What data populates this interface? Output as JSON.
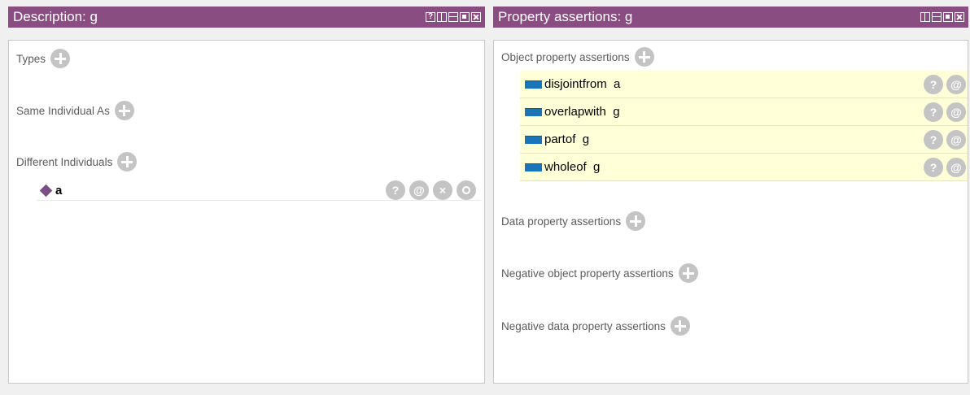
{
  "left_panel": {
    "title": "Description: g",
    "sections": {
      "types": "Types",
      "same_individual": "Same Individual As",
      "different_individuals": "Different Individuals"
    },
    "different_individuals_items": [
      "a"
    ]
  },
  "right_panel": {
    "title": "Property assertions: g",
    "sections": {
      "object_property": "Object property assertions",
      "data_property": "Data property assertions",
      "negative_object": "Negative object property assertions",
      "negative_data": "Negative data property assertions"
    },
    "object_property_assertions": [
      "disjointfrom  a",
      "overlapwith  g",
      "partof  g",
      "wholeof  g"
    ]
  },
  "buttons": {
    "help": "?",
    "annotate": "@",
    "delete": "×"
  },
  "colors": {
    "title_bar": "#894d82",
    "assertion_highlight": "#ffffd8",
    "property_swatch": "#1a74b8",
    "button_gray": "#c4c4c4"
  }
}
